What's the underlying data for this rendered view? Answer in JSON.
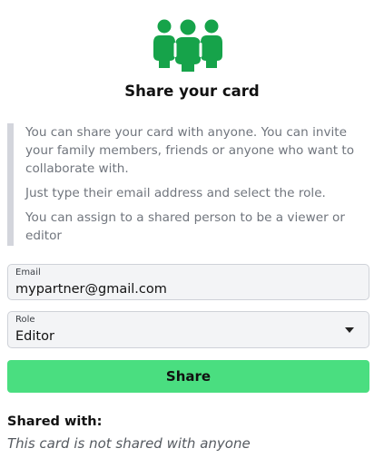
{
  "header": {
    "icon": "users-group-icon",
    "icon_color": "#16a34a",
    "title": "Share your card"
  },
  "info": {
    "paragraphs": [
      "You can share your card with anyone. You can invite your family members, friends or anyone who want to collaborate with.",
      "Just type their email address and select the role.",
      "You can assign to a shared person to be a viewer or editor"
    ]
  },
  "form": {
    "email_label": "Email",
    "email_value": "mypartner@gmail.com",
    "role_label": "Role",
    "role_value": "Editor",
    "role_icon": "caret-down-icon",
    "share_label": "Share",
    "share_color": "#4ade80"
  },
  "shared": {
    "heading": "Shared with:",
    "empty_text": "This card is not shared with anyone"
  }
}
